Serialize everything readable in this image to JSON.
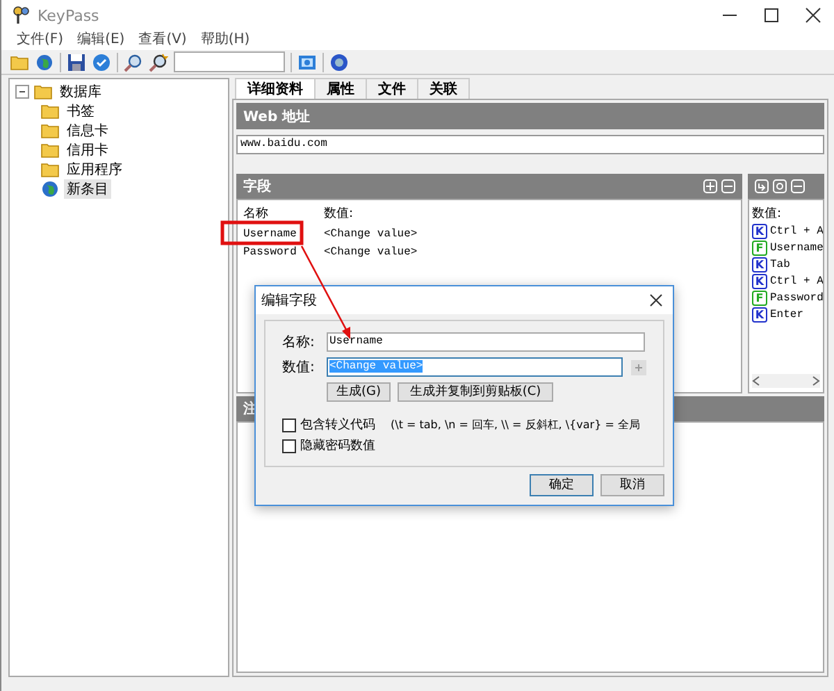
{
  "window": {
    "title": "KeyPass"
  },
  "menu": [
    {
      "label": "文件(F)"
    },
    {
      "label": "编辑(E)"
    },
    {
      "label": "查看(V)"
    },
    {
      "label": "帮助(H)"
    }
  ],
  "tree": {
    "label": "数据库",
    "expanded": true,
    "children": [
      {
        "label": "书签",
        "kind": "folder",
        "selected": false
      },
      {
        "label": "信息卡",
        "kind": "folder",
        "selected": false
      },
      {
        "label": "信用卡",
        "kind": "folder",
        "selected": false
      },
      {
        "label": "应用程序",
        "kind": "folder",
        "selected": false
      },
      {
        "label": "新条目",
        "kind": "entry",
        "selected": true
      }
    ]
  },
  "tabs": [
    {
      "label": "详细资料",
      "selected": true
    },
    {
      "label": "属性",
      "selected": false
    },
    {
      "label": "文件",
      "selected": false
    },
    {
      "label": "关联",
      "selected": false
    }
  ],
  "web": {
    "title": "Web 地址",
    "url": "www.baidu.com"
  },
  "fields": {
    "title": "字段",
    "columns": [
      "名称",
      "数值:"
    ],
    "rows": [
      {
        "name": "Username",
        "value": "<Change value>"
      },
      {
        "name": "Password",
        "value": "<Change value>"
      }
    ]
  },
  "keys": {
    "title": "数值:",
    "items": [
      {
        "kind": "key",
        "badge": "K",
        "text": "Ctrl + A"
      },
      {
        "kind": "field",
        "badge": "F",
        "text": "Username"
      },
      {
        "kind": "key",
        "badge": "K",
        "text": "Tab"
      },
      {
        "kind": "key",
        "badge": "K",
        "text": "Ctrl + A"
      },
      {
        "kind": "field",
        "badge": "F",
        "text": "Password"
      },
      {
        "kind": "key",
        "badge": "K",
        "text": "Enter"
      }
    ]
  },
  "notes": {
    "title": "注"
  },
  "dialog": {
    "title": "编辑字段",
    "name_label": "名称:",
    "name_value": "Username",
    "value_label": "数值:",
    "value_value": "<Change value>",
    "value_selected": true,
    "buttons": [
      {
        "label": "生成(G)"
      },
      {
        "label": "生成并复制到剪贴板(C)"
      }
    ],
    "options": [
      {
        "label": "包含转义代码",
        "hint": "(\\t = tab, \\n = 回车, \\\\ = 反斜杠, \\{var} = 全局",
        "checked": false
      },
      {
        "label": "隐藏密码数值",
        "checked": false
      }
    ],
    "ok": "确定",
    "cancel": "取消"
  }
}
